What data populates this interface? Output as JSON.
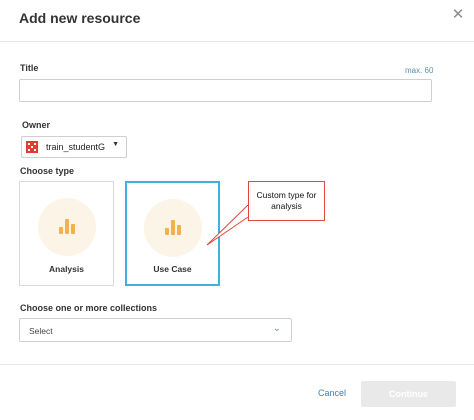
{
  "modal": {
    "title": "Add new resource"
  },
  "title_field": {
    "label": "Title",
    "hint": "max. 60",
    "value": ""
  },
  "owner": {
    "label": "Owner",
    "selected": "train_studentG"
  },
  "type": {
    "label": "Choose type",
    "options": [
      {
        "label": "Analysis",
        "selected": false
      },
      {
        "label": "Use Case",
        "selected": true
      }
    ],
    "callout": [
      "Custom type for",
      "analysis"
    ]
  },
  "collections": {
    "label": "Choose one or more collections",
    "selected": "Select"
  },
  "footer": {
    "cancel_label": "Cancel",
    "continue_label": "Continue"
  },
  "colors": {
    "accent": "#3fb1dc",
    "icon_bars": "#f2b14c",
    "icon_circle": "#fdf4e8",
    "callout_border": "#e0483c",
    "link": "#3a7fb8"
  }
}
